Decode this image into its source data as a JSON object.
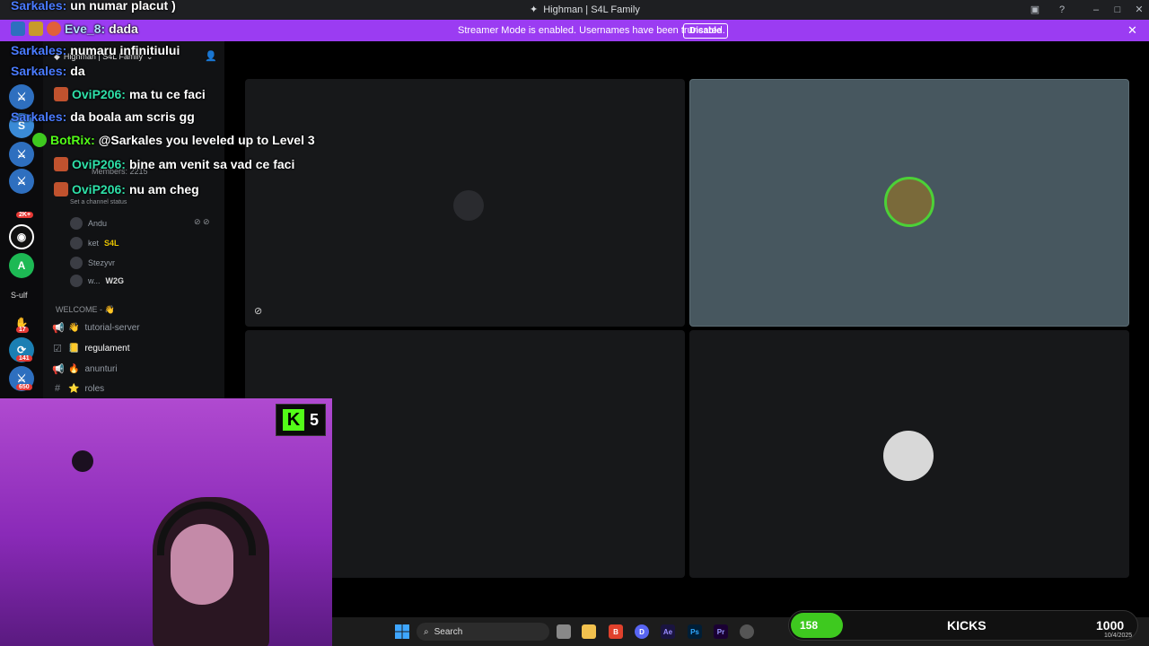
{
  "window": {
    "title": "Highman | S4L Family"
  },
  "streamer_bar": {
    "message": "Streamer Mode is enabled. Usernames have been truncated.",
    "disable_label": "Disable"
  },
  "server": {
    "name": "Highman | S4L Family",
    "members_label": "Members: 2215",
    "status_prompt": "Set a channel status"
  },
  "voice_members": [
    {
      "name": "Andu",
      "tag": ""
    },
    {
      "name": "ket",
      "tag": "S4L"
    },
    {
      "name": "Stezyvr",
      "tag": ""
    },
    {
      "name": "w...",
      "tag": "W2G"
    }
  ],
  "category": {
    "label": "WELCOME - 👋"
  },
  "channels": [
    {
      "name": "tutorial-server",
      "emoji": "👋"
    },
    {
      "name": "regulament",
      "emoji": "📒"
    },
    {
      "name": "anunturi",
      "emoji": "🔥"
    },
    {
      "name": "roles",
      "emoji": "⭐"
    }
  ],
  "rail": {
    "label": "S-ulf",
    "badges": [
      "2K+",
      "17",
      "141",
      "650"
    ],
    "top_badge": "30"
  },
  "chat": [
    {
      "user": "Sarkales:",
      "text": "un numar placut )",
      "color": "#4a7bff"
    },
    {
      "user": "Eve_8:",
      "text": "dada",
      "color": "#b0e0ff"
    },
    {
      "user": "Sarkales:",
      "text": "numaru infinitiului",
      "color": "#4a7bff"
    },
    {
      "user": "Sarkales:",
      "text": "da",
      "color": "#4a7bff"
    },
    {
      "user": "OviP206:",
      "text": "ma tu ce faci",
      "color": "#2ee0a8"
    },
    {
      "user": "Sarkales:",
      "text": "da boala am scris gg",
      "color": "#4a7bff"
    },
    {
      "user": "BotRix:",
      "text": "@Sarkales you leveled up to Level 3",
      "color": "#53fc18"
    },
    {
      "user": "OviP206:",
      "text": "bine am venit sa vad ce faci",
      "color": "#2ee0a8"
    },
    {
      "user": "OviP206:",
      "text": "nu am cheg",
      "color": "#2ee0a8"
    }
  ],
  "kick_badge": {
    "count": "5"
  },
  "taskbar": {
    "search_placeholder": "Search",
    "apps": [
      "Ae",
      "Ps",
      "Pr"
    ],
    "date": "10/4/2025"
  },
  "kicks_goal": {
    "current": "158",
    "label": "KICKS",
    "goal": "1000",
    "progress": 0.158
  },
  "colors": {
    "streamer_bar": "#9b3cf2",
    "kick_green": "#53fc18"
  }
}
